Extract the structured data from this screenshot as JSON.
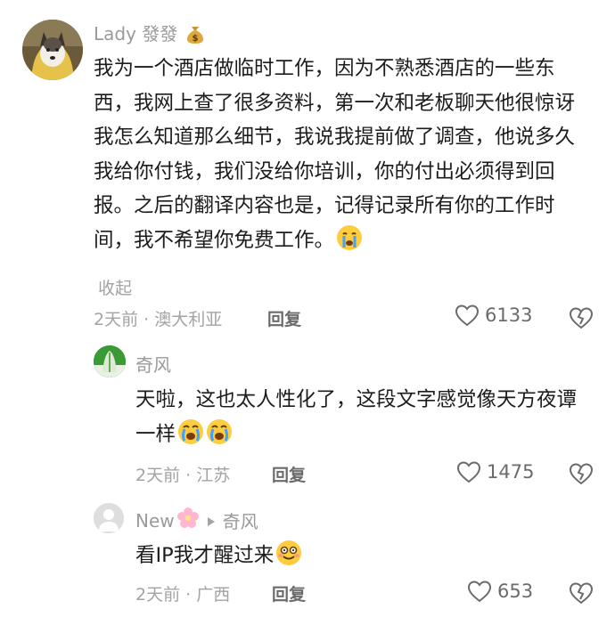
{
  "comments": [
    {
      "user": "Lady 發發",
      "text": "我为一个酒店做临时工作，因为不熟悉酒店的一些东西，我网上查了很多资料，第一次和老板聊天他很惊讶我怎么知道那么细节，我说我提前做了调查，他说多久我给你付钱，我们没给你培训，你的付出必须得到回报。之后的翻译内容也是，记得记录所有你的工作时间，我不希望你免费工作。",
      "collapse": "收起",
      "meta": "2天前 · 澳大利亚",
      "reply": "回复",
      "likes": "6133",
      "user_emoji": "money-bag-icon",
      "end_emoji": "crying-face-icon"
    },
    {
      "user": "奇风",
      "text": "天啦，这也太人性化了，这段文字感觉像天方夜谭一样",
      "meta": "2天前 · 江苏",
      "reply": "回复",
      "likes": "1475",
      "end_emoji": "crying-face-icon"
    },
    {
      "user": "New",
      "user_emoji": "cherry-blossom-icon",
      "reply_to": "奇风",
      "text": "看IP我才醒过来",
      "meta": "2天前 · 广西",
      "reply": "回复",
      "likes": "653",
      "end_emoji": "smiling-face-icon"
    }
  ],
  "colors": {
    "text": "#1c1c1c",
    "muted": "#a3a3a3",
    "reply": "#6b6b6b"
  }
}
